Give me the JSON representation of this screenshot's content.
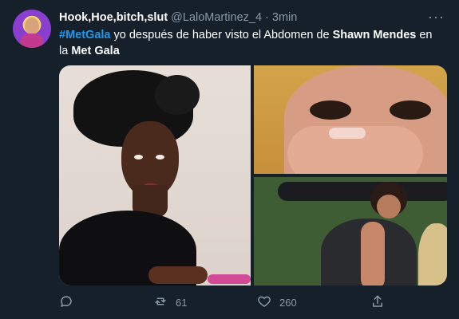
{
  "tweet": {
    "author": {
      "name": "Hook,Hoe,bitch,slut",
      "handle": "@LaloMartinez_4",
      "time_sep": "·",
      "time": "3min"
    },
    "text": {
      "hashtag": "#MetGala",
      "part1": " yo después de haber visto el Abdomen de ",
      "bold_name": "Shawn Mendes",
      "part2": " en la ",
      "bold_end": "Met Gala"
    },
    "media": {
      "images": [
        {
          "name": "left-image"
        },
        {
          "name": "top-right-image"
        },
        {
          "name": "bottom-right-image"
        }
      ]
    },
    "actions": {
      "reply": {
        "icon": "reply-icon",
        "count": ""
      },
      "retweet": {
        "icon": "retweet-icon",
        "count": "61"
      },
      "like": {
        "icon": "heart-icon",
        "count": "260"
      },
      "share": {
        "icon": "share-icon",
        "count": ""
      }
    },
    "more_icon": "···"
  },
  "theme": {
    "background": "#15202b",
    "text": "#ffffff",
    "muted": "#8b98a5",
    "accent": "#1d9bf0"
  }
}
